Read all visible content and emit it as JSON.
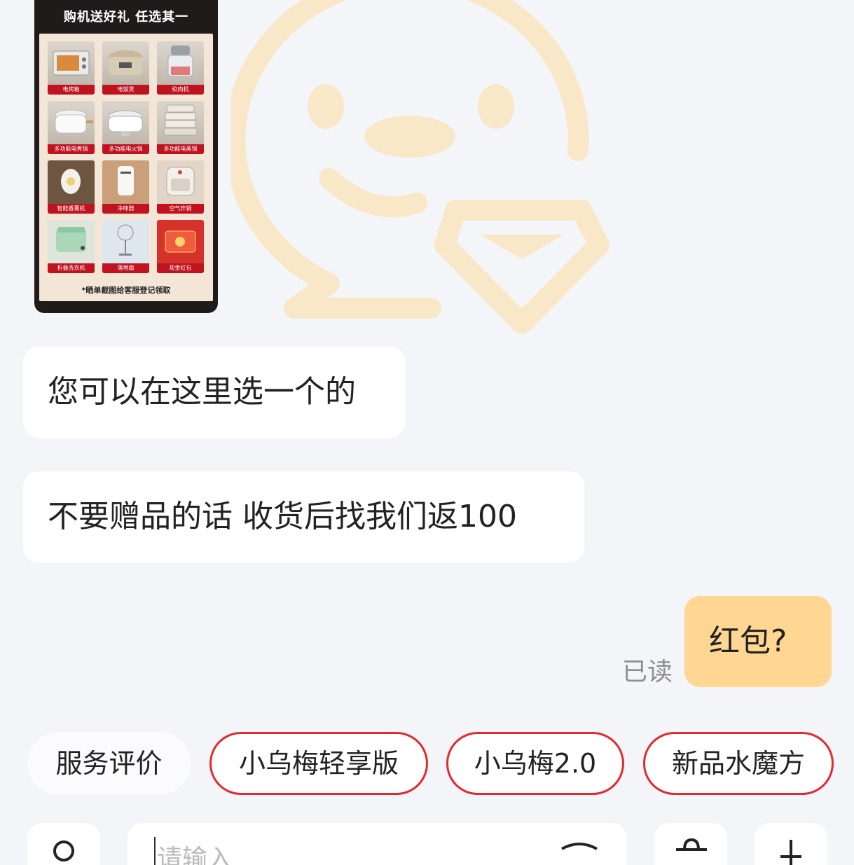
{
  "promo": {
    "title": "购机送好礼 任选其一",
    "gifts": [
      "电烤箱",
      "电饭煲",
      "绞肉机",
      "多功能电煮锅",
      "多功能电火锅",
      "多功能电蒸锅",
      "智能香薰机",
      "净味器",
      "空气炸锅",
      "折叠洗衣机",
      "落地扇",
      "现金红包"
    ],
    "note": "*晒单截图给客服登记领取"
  },
  "messages": [
    {
      "from": "agent",
      "text": "您可以在这里选一个的"
    },
    {
      "from": "agent",
      "text": "不要赠品的话 收货后找我们返100"
    },
    {
      "from": "me",
      "text": "红包?",
      "status": "已读"
    }
  ],
  "quick_replies": [
    "服务评价",
    "小乌梅轻享版",
    "小乌梅2.0",
    "新品水魔方"
  ],
  "input": {
    "placeholder": "请输入"
  },
  "colors": {
    "accent": "#e22a2f",
    "my_bubble": "#ffd792",
    "background": "#f4f5f9"
  }
}
